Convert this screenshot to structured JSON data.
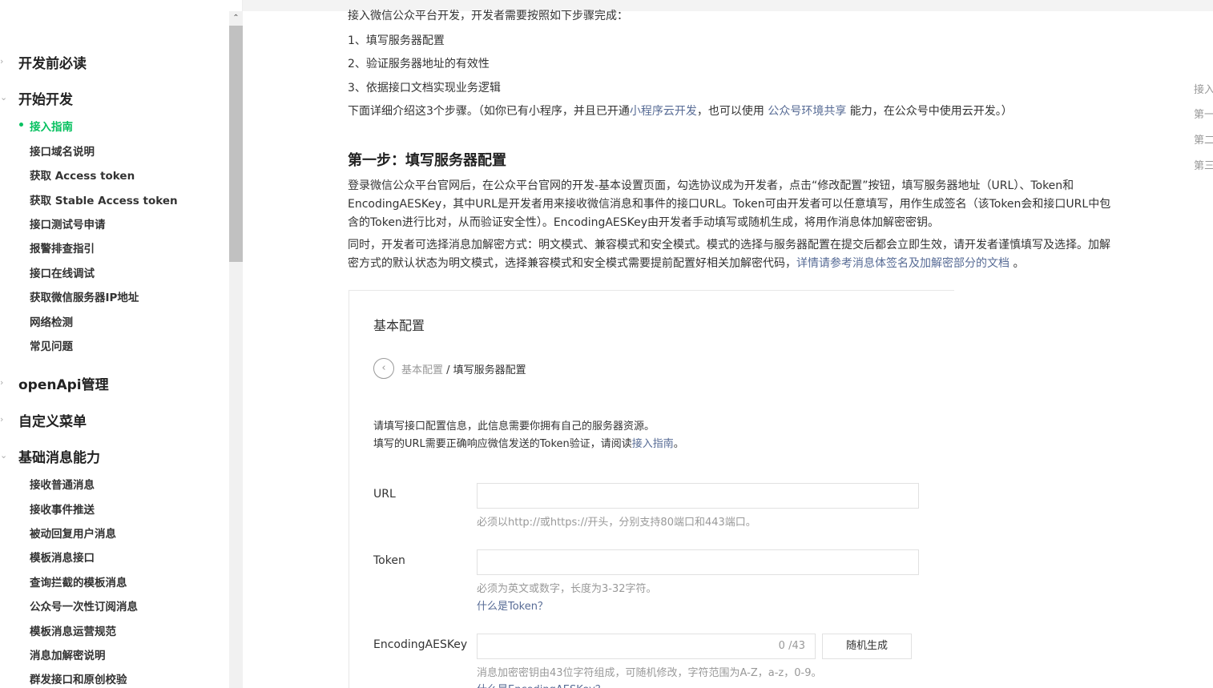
{
  "sidebar": {
    "groups": [
      {
        "label": "开发前必读",
        "chevron": "›"
      },
      {
        "label": "开始开发",
        "chevron": "⌄"
      },
      {
        "label": "openApi管理",
        "chevron": "›"
      },
      {
        "label": "自定义菜单",
        "chevron": "›"
      },
      {
        "label": "基础消息能力",
        "chevron": "⌄"
      }
    ],
    "start_dev_items": [
      "接入指南",
      "接口域名说明",
      "获取 Access token",
      "获取 Stable Access token",
      "接口测试号申请",
      "报警排查指引",
      "接口在线调试",
      "获取微信服务器IP地址",
      "网络检测",
      "常见问题"
    ],
    "basic_msg_items": [
      "接收普通消息",
      "接收事件推送",
      "被动回复用户消息",
      "模板消息接口",
      "查询拦截的模板消息",
      "公众号一次性订阅消息",
      "模板消息运营规范",
      "消息加解密说明",
      "群发接口和原创校验"
    ],
    "scroll_up_arrow": "⌃"
  },
  "content": {
    "intro": "接入微信公众平台开发，开发者需要按照如下步骤完成：",
    "steps": [
      "1、填写服务器配置",
      "2、验证服务器地址的有效性",
      "3、依据接口文档实现业务逻辑"
    ],
    "detail_pre": "下面详细介绍这3个步骤。（如你已有小程序，并且已开通",
    "detail_link1": "小程序云开发",
    "detail_mid": "，也可以使用 ",
    "detail_link2": "公众号环境共享",
    "detail_post": " 能力，在公众号中使用云开发。）",
    "step1_title": "第一步：填写服务器配置",
    "para1": "登录微信公众平台官网后，在公众平台官网的开发-基本设置页面，勾选协议成为开发者，点击“修改配置”按钮，填写服务器地址（URL）、Token和EncodingAESKey，其中URL是开发者用来接收微信消息和事件的接口URL。Token可由开发者可以任意填写，用作生成签名（该Token会和接口URL中包含的Token进行比对，从而验证安全性）。EncodingAESKey由开发者手动填写或随机生成，将用作消息体加解密密钥。",
    "para2_pre": "同时，开发者可选择消息加解密方式：明文模式、兼容模式和安全模式。模式的选择与服务器配置在提交后都会立即生效，请开发者谨慎填写及选择。加解密方式的默认状态为明文模式，选择兼容模式和安全模式需要提前配置好相关加解密代码，",
    "para2_link": "详情请参考消息体签名及加解密部分的文档",
    "para2_post": " 。"
  },
  "panel": {
    "title": "基本配置",
    "back_icon": "‹",
    "crumb_parent": "基本配置",
    "crumb_sep": " / ",
    "crumb_current": "填写服务器配置",
    "info1": "请填写接口配置信息，此信息需要你拥有自己的服务器资源。",
    "info2_pre": "填写的URL需要正确响应微信发送的Token验证，请阅读",
    "info2_link": "接入指南",
    "info2_post": "。",
    "url_label": "URL",
    "url_hint": "必须以http://或https://开头，分别支持80端口和443端口。",
    "token_label": "Token",
    "token_hint": "必须为英文或数字，长度为3-32字符。",
    "token_link": "什么是Token？",
    "aes_label": "EncodingAESKey",
    "aes_counter": "0 /43",
    "aes_button": "随机生成",
    "aes_hint": "消息加密密钥由43位字符组成，可随机修改，字符范围为A-Z，a-z，0-9。",
    "aes_link": "什么是EncodingAESKey？"
  },
  "toc": [
    "接入",
    "第一",
    "第二",
    "第三"
  ],
  "colors": {
    "accent_green": "#07c160",
    "link_blue": "#576b95"
  }
}
